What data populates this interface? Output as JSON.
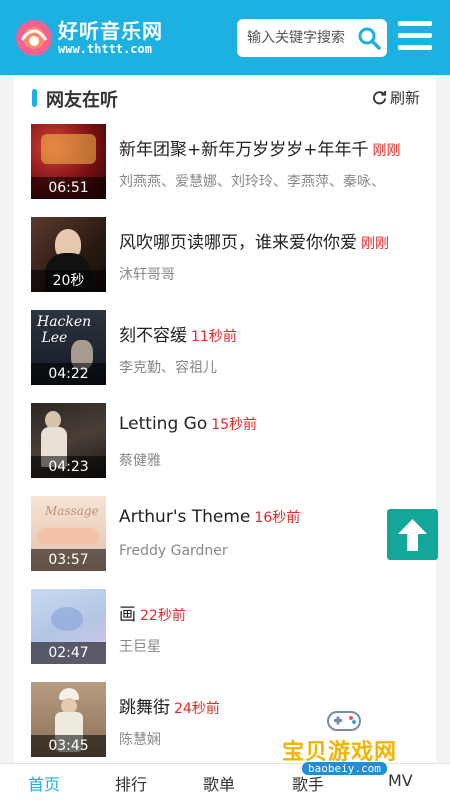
{
  "header": {
    "brand": "好听音乐网",
    "brand_sub": "www.thttt.com",
    "search_placeholder": "输入关键字搜索",
    "accent_color": "#1cb1e0"
  },
  "section": {
    "title": "网友在听",
    "refresh_label": "刷新"
  },
  "items": [
    {
      "title": "新年团聚+新年万岁岁岁+年年千",
      "time": "刚刚",
      "artist": "刘燕燕、爱慧娜、刘玲玲、李燕萍、秦咏、",
      "duration": "06:51"
    },
    {
      "title": "风吹哪页读哪页，谁来爱你你爱",
      "time": "刚刚",
      "artist": "沐轩哥哥",
      "duration": "20秒"
    },
    {
      "title": "刻不容缓",
      "time": "11秒前",
      "artist": "李克勤、容祖儿",
      "duration": "04:22"
    },
    {
      "title": "Letting Go",
      "time": "15秒前",
      "artist": "蔡健雅",
      "duration": "04:23"
    },
    {
      "title": "Arthur's Theme",
      "time": "16秒前",
      "artist": "Freddy Gardner",
      "duration": "03:57"
    },
    {
      "title": "画",
      "time": "22秒前",
      "artist": "王巨星",
      "duration": "02:47"
    },
    {
      "title": "跳舞街",
      "time": "24秒前",
      "artist": "陈慧娴",
      "duration": "03:45"
    }
  ],
  "bottom_nav": [
    "首页",
    "排行",
    "歌单",
    "歌手",
    "MV"
  ],
  "watermark": {
    "text": "宝贝游戏网",
    "url": "baobeiy.com"
  }
}
